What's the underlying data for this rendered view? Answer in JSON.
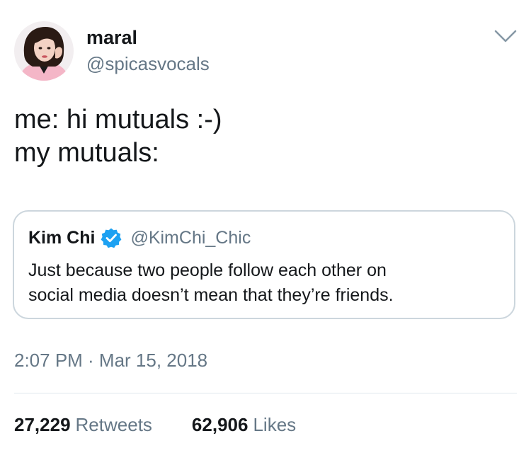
{
  "tweet": {
    "author": {
      "display_name": "maral",
      "handle": "@spicasvocals"
    },
    "text_lines": [
      "me: hi mutuals :-)",
      "my mutuals:"
    ],
    "menu_icon": "chevron-down-icon",
    "quoted": {
      "display_name": "Kim Chi",
      "verified_icon": "verified-badge-icon",
      "handle": "@KimChi_Chic",
      "text_lines": [
        "Just because two people follow each other on",
        "social media doesn’t mean that they’re friends."
      ]
    },
    "timestamp": "2:07 PM · Mar 15, 2018",
    "stats": {
      "retweets_count": "27,229",
      "retweets_label": "Retweets",
      "likes_count": "62,906",
      "likes_label": "Likes"
    }
  },
  "colors": {
    "text_primary": "#14171a",
    "text_secondary": "#657786",
    "border": "#ccd6dd",
    "verified_blue": "#1da1f2",
    "avatar_pink": "#f4b6c7"
  }
}
